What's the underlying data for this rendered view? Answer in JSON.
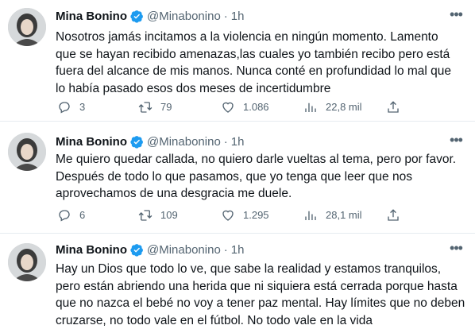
{
  "tweets": [
    {
      "name": "Mina Bonino",
      "handle": "@Minabonino",
      "separator": "·",
      "time": "1h",
      "text": "Nosotros jamás incitamos a la violencia en ningún momento. Lamento\nque se hayan recibido amenazas,las cuales yo también recibo pero está\nfuera del alcance de mis manos. Nunca conté en profundidad lo mal que\nlo había pasado esos dos meses de incertidumbre",
      "replies": "3",
      "retweets": "79",
      "likes": "1.086",
      "views": "22,8 mil"
    },
    {
      "name": "Mina Bonino",
      "handle": "@Minabonino",
      "separator": "·",
      "time": "1h",
      "text": "Me quiero quedar callada, no quiero darle vueltas al tema, pero por favor.\nDespués de todo lo que pasamos, que yo tenga que leer que nos\naprovechamos de una desgracia me duele.",
      "replies": "6",
      "retweets": "109",
      "likes": "1.295",
      "views": "28,1 mil"
    },
    {
      "name": "Mina Bonino",
      "handle": "@Minabonino",
      "separator": "·",
      "time": "1h",
      "text": "Hay un Dios que todo lo ve, que sabe la realidad y estamos tranquilos,\npero están abriendo una herida que ni siquiera está cerrada porque hasta\nque no nazca el bebé no voy a tener paz mental. Hay límites que no deben\ncruzarse, no todo vale en el fútbol. No todo vale en la vida"
    }
  ],
  "icons": {
    "verified": "verified-badge-icon",
    "more": "more-icon",
    "reply": "reply-icon",
    "retweet": "retweet-icon",
    "like": "heart-icon",
    "views": "views-icon",
    "share": "share-icon"
  },
  "colors": {
    "verified": "#1d9bf0",
    "secondary_text": "#536471",
    "divider": "#e6ecf0"
  }
}
